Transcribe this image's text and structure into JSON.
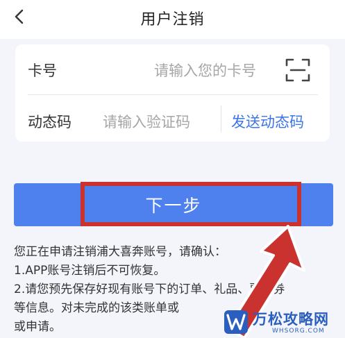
{
  "header": {
    "back_icon": "chevron-left-icon",
    "title": "用户注销"
  },
  "form": {
    "card_number": {
      "label": "卡号",
      "placeholder": "请输入您的卡号",
      "scan_icon": "scan-icon"
    },
    "dynamic_code": {
      "label": "动态码",
      "placeholder": "请输入验证码",
      "send_button": "发送动态码"
    }
  },
  "next_button": {
    "label": "下一步"
  },
  "notice": {
    "lines": [
      "您正在申请注销浦大喜奔账号，请确认：",
      "1.APP账号注销后不可恢复。",
      "2.请您预先保存好现有账号下的订单、礼品、票、券",
      "等信息。对未完成的该类账单或",
      "或申请。"
    ]
  },
  "annotation": {
    "highlight_color": "#c9322e"
  },
  "watermark": {
    "title": "万松攻略网",
    "subtitle": "WHSORG.COM"
  },
  "colors": {
    "accent": "#4e80ee",
    "link": "#3b74ea",
    "background": "#f3f5fb"
  }
}
